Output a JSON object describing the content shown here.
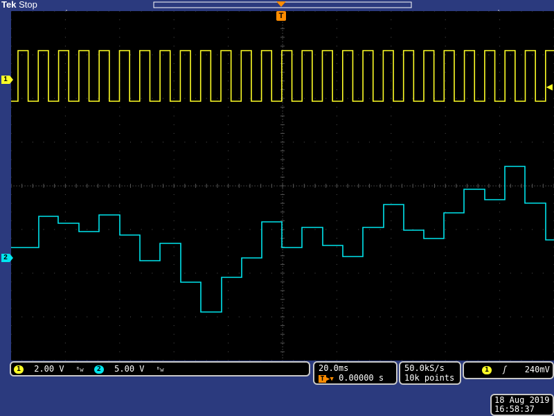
{
  "brand": {
    "name": "Tek",
    "status": "Stop"
  },
  "trigger_badge": "T",
  "channels": [
    {
      "id": "1",
      "scale": "2.00 V",
      "coupling_icon": "bandwidth-limit-icon",
      "color": "#ffff26"
    },
    {
      "id": "2",
      "scale": "5.00 V",
      "coupling_icon": "bandwidth-limit-icon",
      "color": "#00e5ee"
    }
  ],
  "timebase": {
    "scale": "20.0ms",
    "position": "0.00000 s"
  },
  "acquisition": {
    "rate": "50.0kS/s",
    "points": "10k points"
  },
  "trigger": {
    "source": "1",
    "slope_icon": "rising-edge-icon",
    "level": "240mV"
  },
  "datetime": {
    "date": "18 Aug 2019",
    "time": "16:58:37"
  },
  "colors": {
    "ch1": "#ffff26",
    "ch2": "#00e5ee",
    "grid": "#555555",
    "trigger_marker": "#ff8c00"
  }
}
